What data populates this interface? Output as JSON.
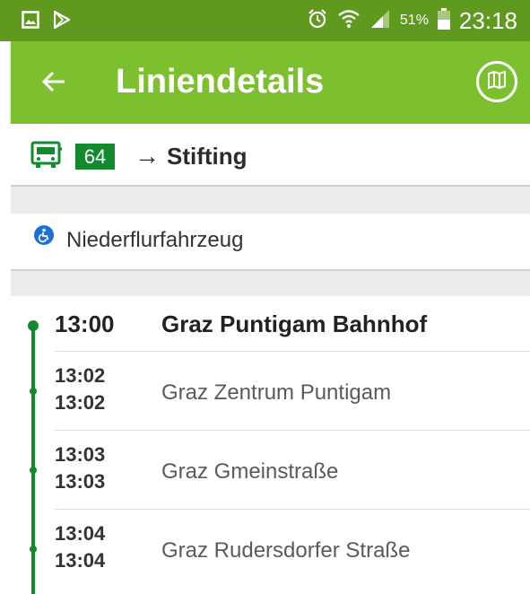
{
  "status_bar": {
    "battery_percent": "51%",
    "time": "23:18",
    "left_icons": [
      "gallery-icon",
      "play-store-icon"
    ],
    "right_icons": [
      "alarm-icon",
      "wifi-icon",
      "signal-icon",
      "battery-icon"
    ]
  },
  "app_bar": {
    "title": "Liniendetails",
    "back_icon": "arrow-left-icon",
    "map_icon": "map-icon"
  },
  "line": {
    "number": "64",
    "arrow": "→",
    "destination": "Stifting",
    "vehicle_icon": "bus-icon"
  },
  "features": [
    {
      "icon": "wheelchair-icon",
      "label": "Niederflurfahrzeug"
    }
  ],
  "stops": [
    {
      "arrival": "13:00",
      "departure": "",
      "name": "Graz Puntigam Bahnhof"
    },
    {
      "arrival": "13:02",
      "departure": "13:02",
      "name": "Graz Zentrum Puntigam"
    },
    {
      "arrival": "13:03",
      "departure": "13:03",
      "name": "Graz Gmeinstraße"
    },
    {
      "arrival": "13:04",
      "departure": "13:04",
      "name": "Graz Rudersdorfer Straße"
    }
  ],
  "colors": {
    "status_bar": "#5f9a1e",
    "app_bar": "#7cbf2f",
    "line_badge": "#148a2e",
    "timeline": "#148a2e",
    "accessibility": "#1e6fd1"
  }
}
